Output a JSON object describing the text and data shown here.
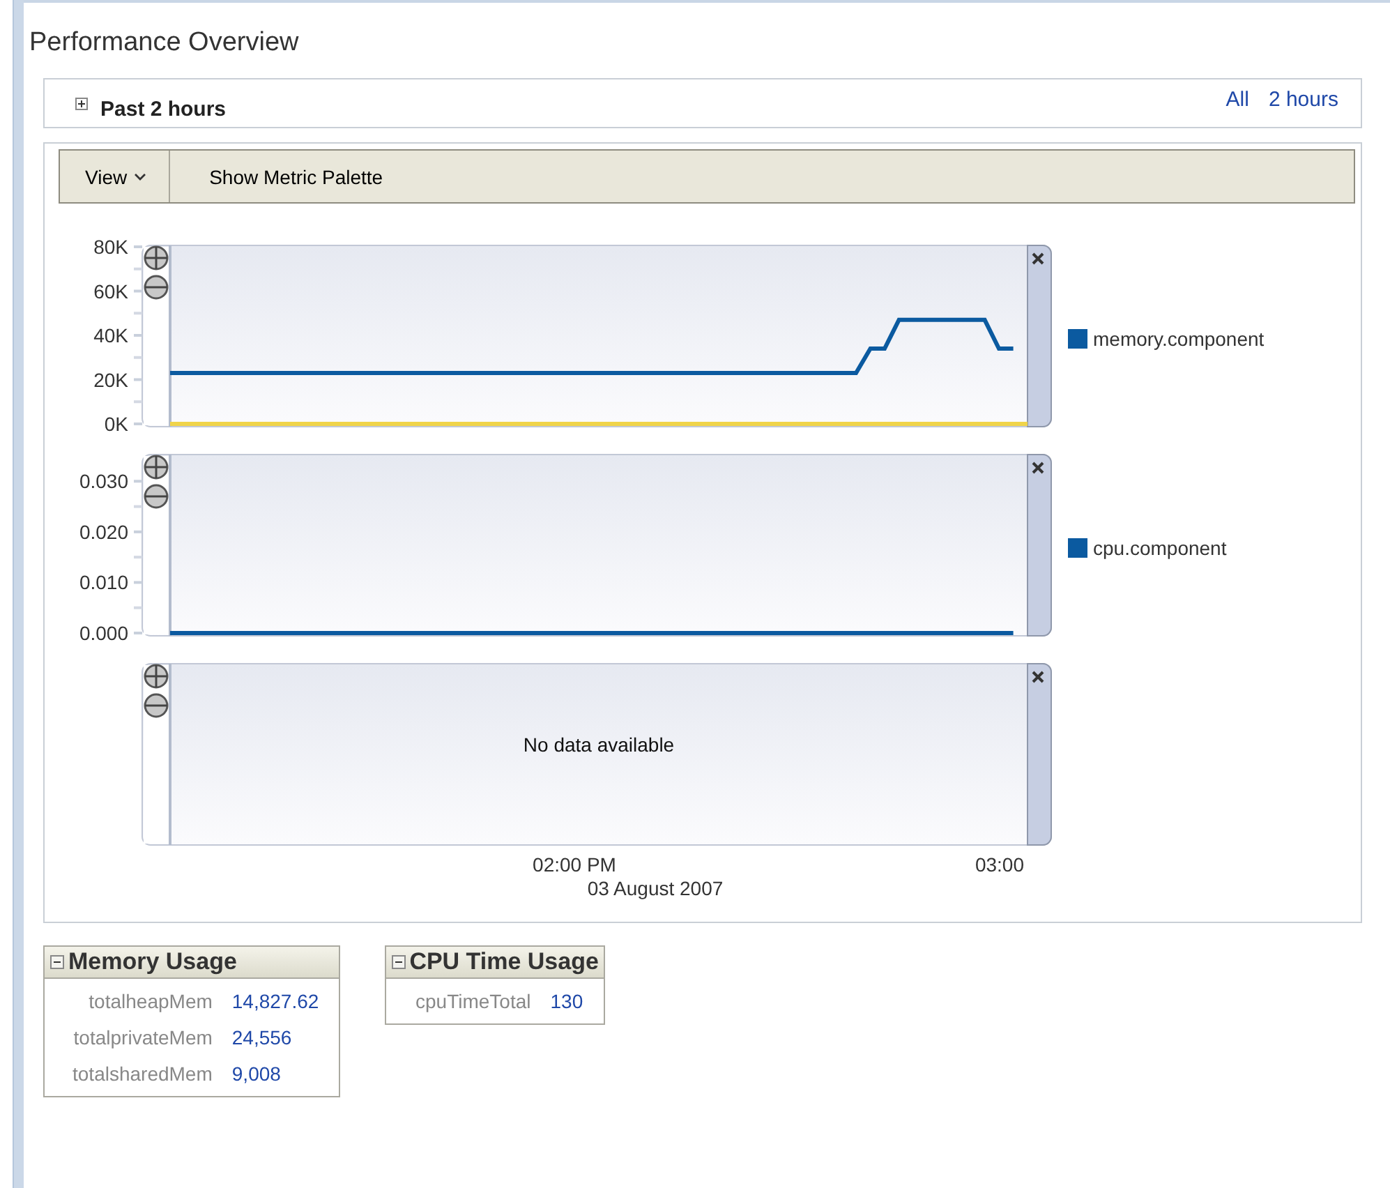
{
  "page": {
    "title": "Performance Overview"
  },
  "time_range": {
    "label": "Past 2 hours",
    "expanded": false,
    "links": [
      "All",
      "2 hours"
    ]
  },
  "toolbar": {
    "view_menu": "View",
    "palette_button": "Show Metric Palette"
  },
  "panels": [
    {
      "kind": "chart",
      "chart_data": {
        "type": "line",
        "categories": [
          null,
          null,
          null,
          null,
          null,
          null,
          null,
          null,
          null,
          null,
          null,
          null,
          null,
          null,
          null,
          null,
          null,
          null,
          null,
          null,
          null,
          null,
          null,
          null,
          null,
          null,
          null,
          null,
          null,
          null,
          null,
          null,
          null,
          null,
          null,
          null,
          null,
          null,
          null,
          null,
          null,
          null,
          null,
          null,
          null,
          null,
          null,
          null,
          null,
          null,
          null,
          null,
          null,
          null,
          null,
          null,
          null,
          null,
          null,
          null,
          null
        ],
        "ylim": [
          0,
          80000
        ],
        "yticks": [
          {
            "value": 0,
            "label": "0K"
          },
          {
            "value": 20000,
            "label": "20K"
          },
          {
            "value": 40000,
            "label": "40K"
          },
          {
            "value": 60000,
            "label": "60K"
          },
          {
            "value": 80000,
            "label": "80K"
          }
        ],
        "series": [
          {
            "name": "memory.component",
            "color": "#0b5aa0",
            "values": [
              23000,
              23000,
              23000,
              23000,
              23000,
              23000,
              23000,
              23000,
              23000,
              23000,
              23000,
              23000,
              23000,
              23000,
              23000,
              23000,
              23000,
              23000,
              23000,
              23000,
              23000,
              23000,
              23000,
              23000,
              23000,
              23000,
              23000,
              23000,
              23000,
              23000,
              23000,
              23000,
              23000,
              23000,
              23000,
              23000,
              23000,
              23000,
              23000,
              23000,
              23000,
              23000,
              23000,
              23000,
              23000,
              23000,
              23000,
              23000,
              23000,
              34000,
              34000,
              47000,
              47000,
              47000,
              47000,
              47000,
              47000,
              47000,
              34000,
              34000,
              null
            ]
          },
          {
            "color": "#f0d44a",
            "values": [
              0,
              0,
              0,
              0,
              0,
              0,
              0,
              0,
              0,
              0,
              0,
              0,
              0,
              0,
              0,
              0,
              0,
              0,
              0,
              0,
              0,
              0,
              0,
              0,
              0,
              0,
              0,
              0,
              0,
              0,
              0,
              0,
              0,
              0,
              0,
              0,
              0,
              0,
              0,
              0,
              0,
              0,
              0,
              0,
              0,
              0,
              0,
              0,
              0,
              0,
              0,
              0,
              0,
              0,
              0,
              0,
              0,
              0,
              0,
              0,
              0
            ]
          }
        ]
      }
    },
    {
      "kind": "chart",
      "chart_data": {
        "type": "line",
        "categories": [
          null,
          null,
          null,
          null,
          null,
          null,
          null,
          null,
          null,
          null,
          null,
          null,
          null,
          null,
          null,
          null,
          null,
          null,
          null,
          null,
          null,
          null,
          null,
          null,
          null,
          null,
          null,
          null,
          null,
          null,
          null,
          null,
          null,
          null,
          null,
          null,
          null,
          null,
          null,
          null,
          null,
          null,
          null,
          null,
          null,
          null,
          null,
          null,
          null,
          null,
          null,
          null,
          null,
          null,
          null,
          null,
          null,
          null,
          null,
          null,
          null
        ],
        "ylim": [
          0,
          0.035
        ],
        "yticks": [
          {
            "value": 0,
            "label": "0.000"
          },
          {
            "value": 0.01,
            "label": "0.010"
          },
          {
            "value": 0.02,
            "label": "0.020"
          },
          {
            "value": 0.03,
            "label": "0.030"
          }
        ],
        "series": [
          {
            "name": "cpu.component",
            "color": "#0b5aa0",
            "values": [
              0,
              0,
              0,
              0,
              0,
              0,
              0,
              0,
              0,
              0,
              0,
              0,
              0,
              0,
              0,
              0,
              0,
              0,
              0,
              0,
              0,
              0,
              0,
              0,
              0,
              0,
              0,
              0,
              0,
              0,
              0,
              0,
              0,
              0,
              0,
              0,
              0,
              0,
              0,
              0,
              0,
              0,
              0,
              0,
              0,
              0,
              0,
              0,
              0,
              0,
              0,
              0,
              0,
              0,
              0,
              0,
              0,
              0,
              0,
              0,
              null
            ]
          }
        ]
      }
    },
    {
      "kind": "empty",
      "message": "No data available"
    }
  ],
  "x_axis": {
    "ticks": [
      "02:00 PM",
      "03:00"
    ],
    "title": "03 August 2007"
  },
  "summaries": [
    {
      "title": "Memory Usage",
      "expanded": true,
      "rows": [
        {
          "name": "totalheapMem",
          "value": "14,827.62"
        },
        {
          "name": "totalprivateMem",
          "value": "24,556"
        },
        {
          "name": "totalsharedMem",
          "value": "9,008"
        }
      ]
    },
    {
      "title": "CPU Time Usage",
      "expanded": true,
      "rows": [
        {
          "name": "cpuTimeTotal",
          "value": "130"
        }
      ]
    }
  ]
}
